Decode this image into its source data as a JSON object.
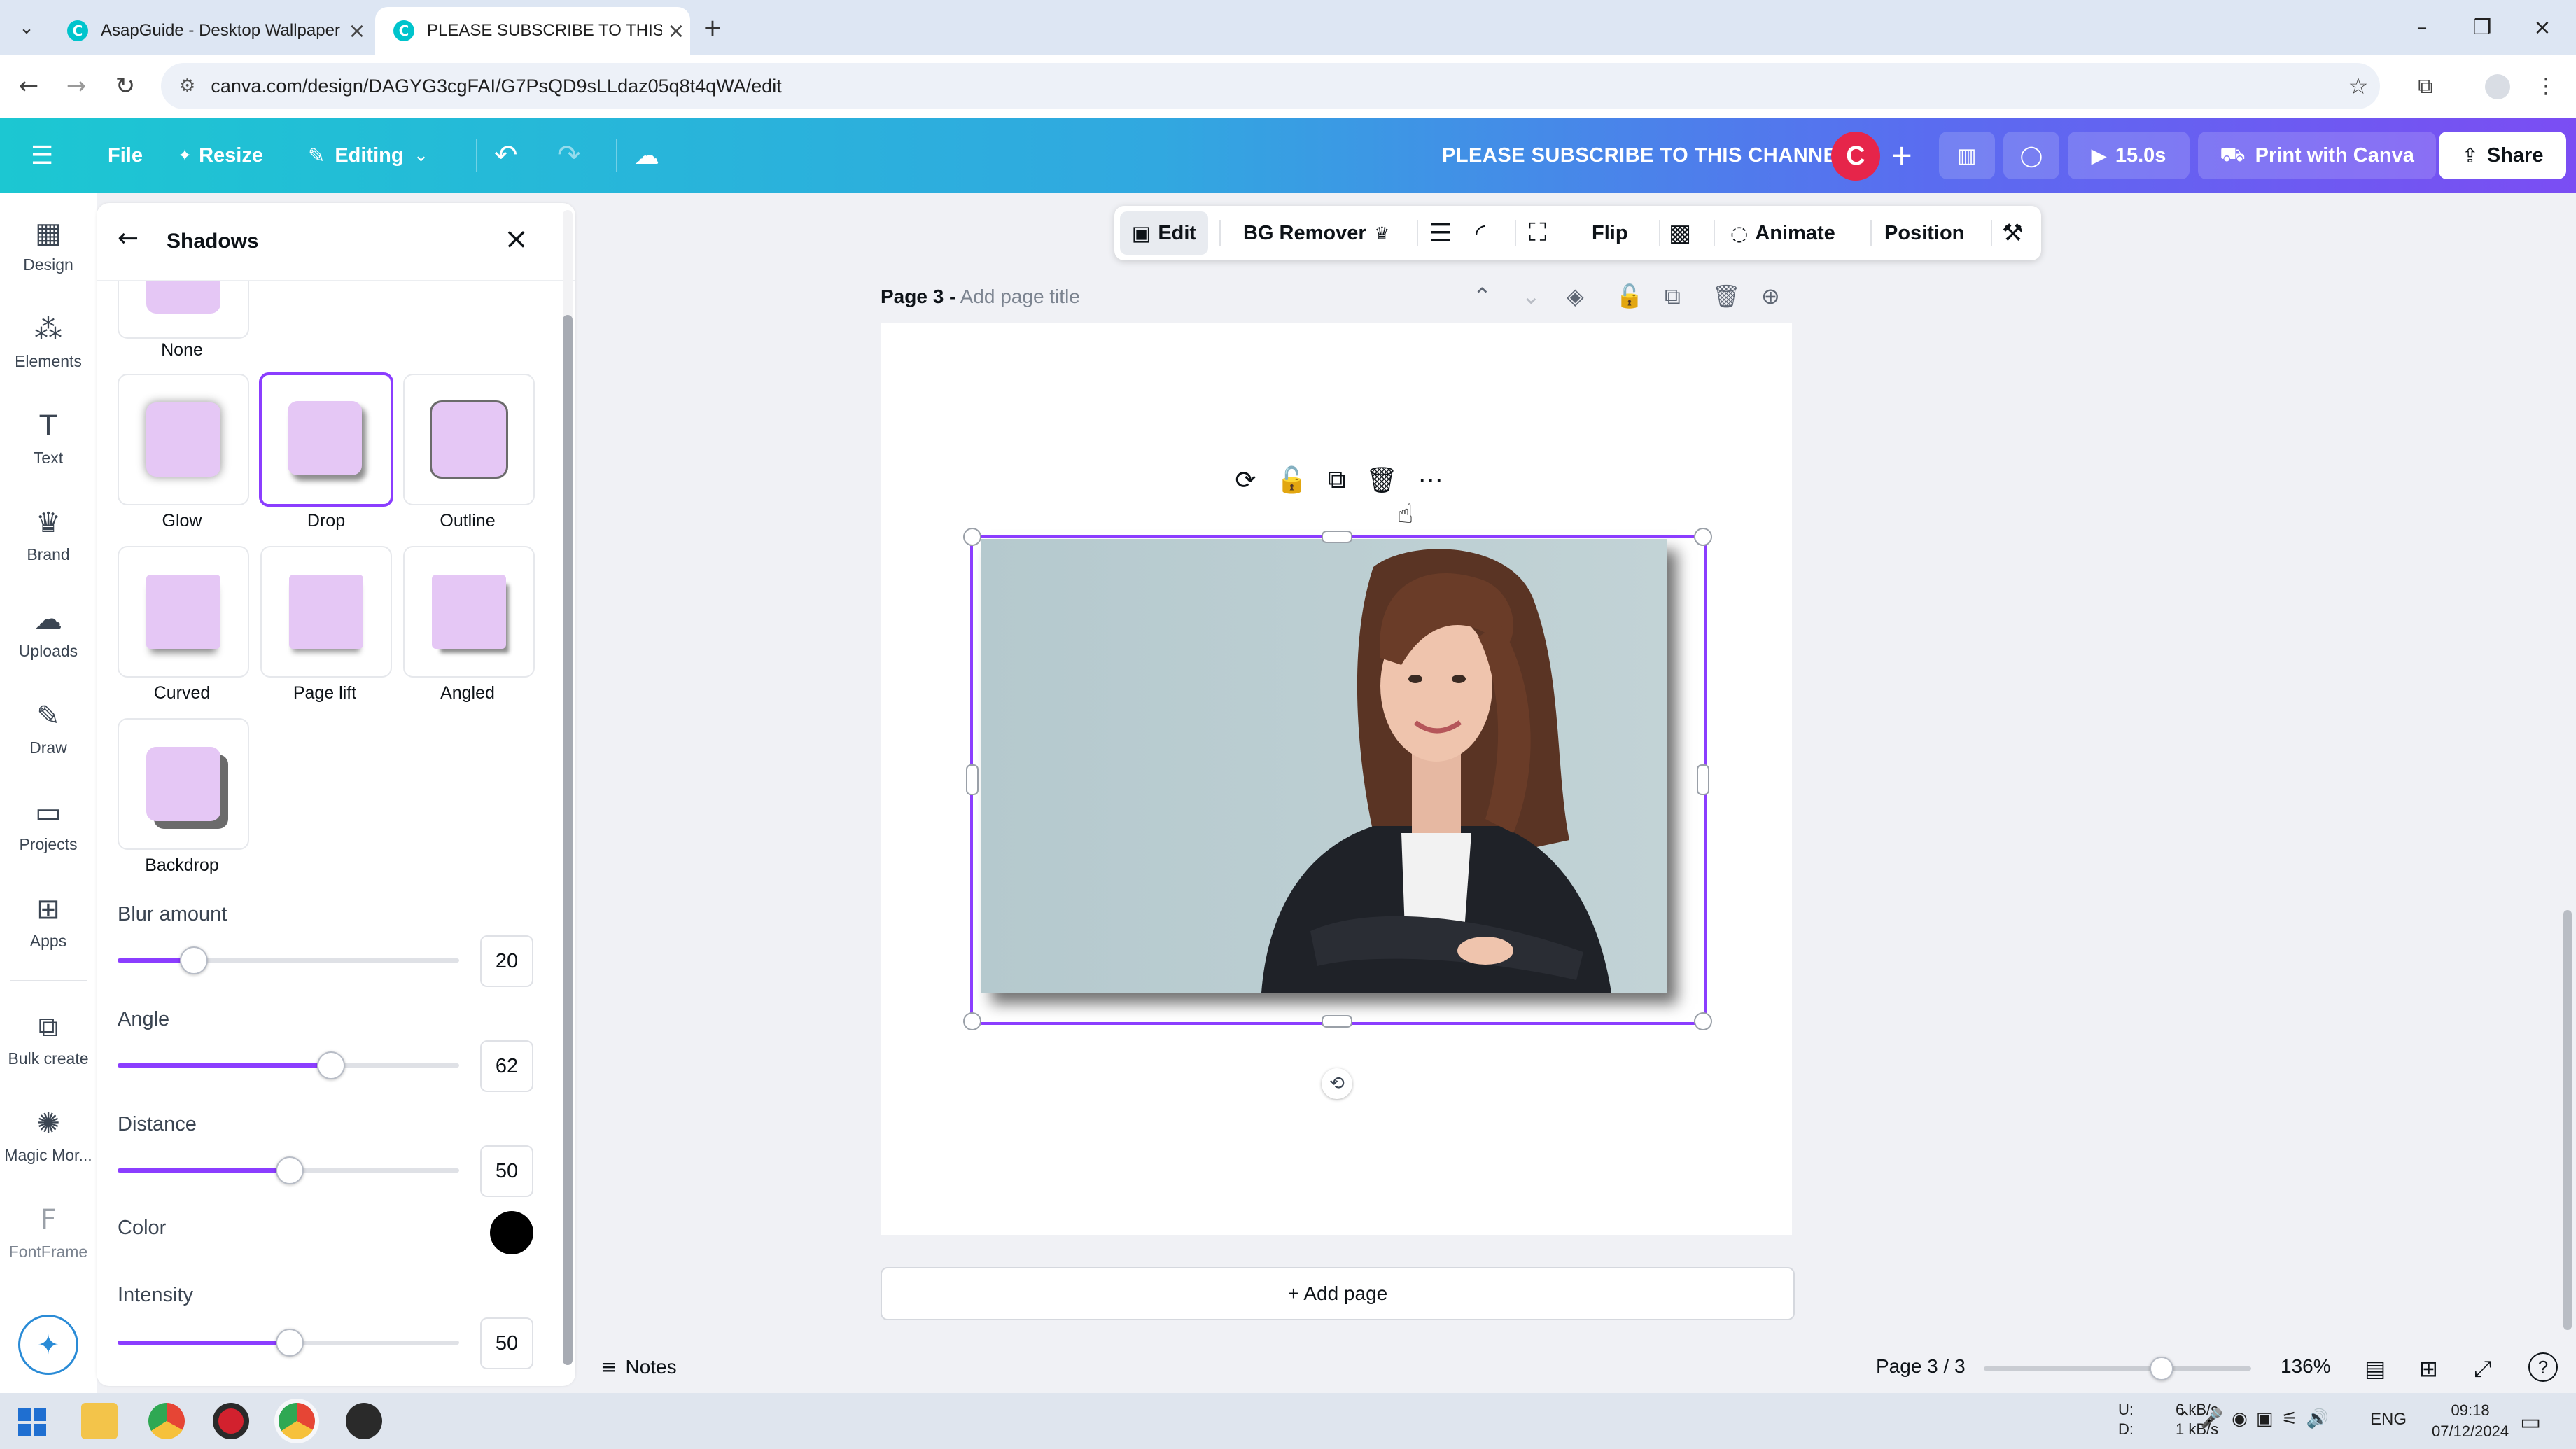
{
  "browser": {
    "tabs": [
      {
        "title": "AsapGuide - Desktop Wallpaper",
        "active": false
      },
      {
        "title": "PLEASE SUBSCRIBE TO THIS CH",
        "active": true
      }
    ],
    "url": "canva.com/design/DAGYG3cgFAI/G7PsQD9sLLdaz05q8t4qWA/edit"
  },
  "header": {
    "file": "File",
    "resize": "Resize",
    "editing": "Editing",
    "doc_title": "PLEASE SUBSCRIBE TO THIS CHANNEL",
    "avatar": "C",
    "duration": "15.0s",
    "print": "Print with Canva",
    "share": "Share"
  },
  "rail": [
    {
      "label": "Design",
      "icon": "design-icon"
    },
    {
      "label": "Elements",
      "icon": "elements-icon"
    },
    {
      "label": "Text",
      "icon": "text-icon"
    },
    {
      "label": "Brand",
      "icon": "brand-icon"
    },
    {
      "label": "Uploads",
      "icon": "uploads-icon"
    },
    {
      "label": "Draw",
      "icon": "draw-icon"
    },
    {
      "label": "Projects",
      "icon": "projects-icon"
    },
    {
      "label": "Apps",
      "icon": "apps-icon"
    },
    {
      "label": "Bulk create",
      "icon": "bulk-create-icon"
    },
    {
      "label": "Magic Mor...",
      "icon": "magic-morph-icon"
    },
    {
      "label": "FontFrame",
      "icon": "fontframe-icon"
    }
  ],
  "panel": {
    "title": "Shadows",
    "options": [
      "None",
      "Glow",
      "Drop",
      "Outline",
      "Curved",
      "Page lift",
      "Angled",
      "Backdrop"
    ],
    "selected": "Drop",
    "sliders": [
      {
        "label": "Blur amount",
        "value": "20",
        "fraction": 0.22
      },
      {
        "label": "Angle",
        "value": "62",
        "fraction": 0.62
      },
      {
        "label": "Distance",
        "value": "50",
        "fraction": 0.5
      },
      {
        "label": "Intensity",
        "value": "50",
        "fraction": 0.5
      }
    ],
    "color_label": "Color",
    "shadow_color": "#000000"
  },
  "toolbar": {
    "edit": "Edit",
    "bg_remover": "BG Remover",
    "flip": "Flip",
    "animate": "Animate",
    "position": "Position"
  },
  "page": {
    "label_prefix": "Page 3 -",
    "title_placeholder": "Add page title",
    "add_page": "+ Add page"
  },
  "footer": {
    "notes": "Notes",
    "page_counter": "Page 3 / 3",
    "zoom": "136%",
    "zoom_fraction": 0.66
  },
  "taskbar": {
    "net_up_label": "U:",
    "net_down_label": "D:",
    "net_up": "6 kB/s",
    "net_down": "1 kB/s",
    "lang": "ENG",
    "time": "09:18",
    "date": "07/12/2024"
  },
  "colors": {
    "accent": "#8b3dff",
    "tile_fill": "#e5c7f5"
  }
}
